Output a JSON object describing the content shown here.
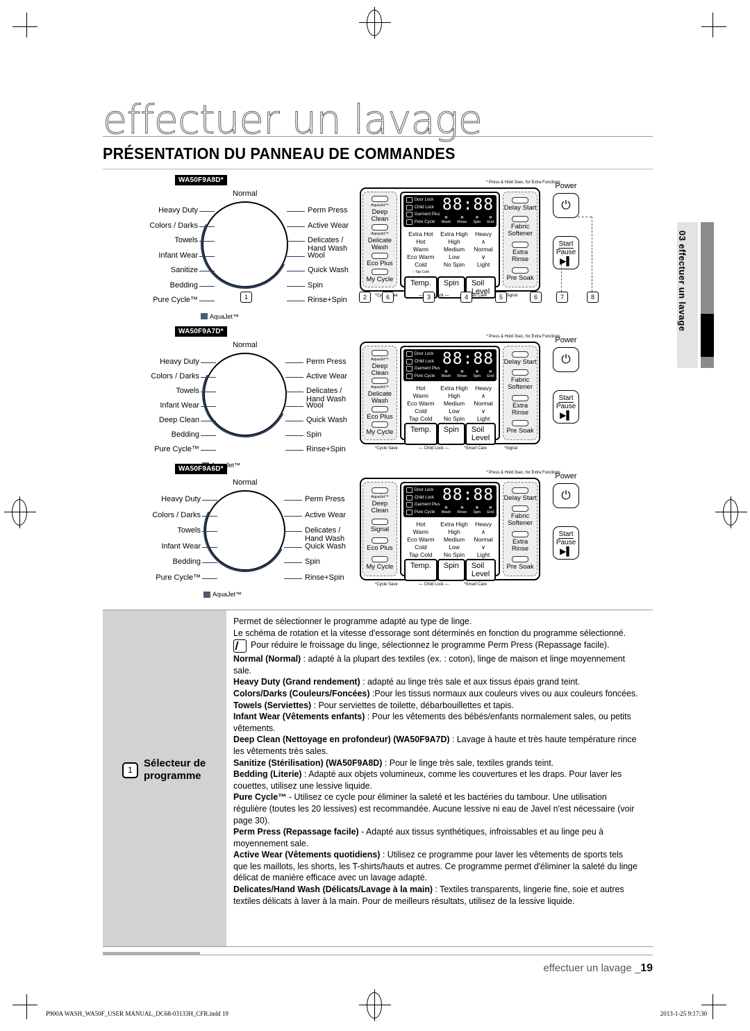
{
  "header": {
    "page_title": "effectuer un lavage",
    "section_title": "PRÉSENTATION DU PANNEAU DE COMMANDES",
    "side_tab": "03 effectuer un lavage"
  },
  "panels": [
    {
      "model": "WA50F9A8D*",
      "dial_left": [
        "Heavy Duty",
        "Colors / Darks",
        "Towels",
        "Infant Wear",
        "Sanitize",
        "Bedding",
        "Pure Cycle™"
      ],
      "dial_top": "Normal",
      "dial_right": [
        "Perm Press",
        "Active Wear",
        "Delicates /\nHand Wash",
        "Wool",
        "Quick Wash",
        "Spin",
        "Rinse+Spin"
      ],
      "aqua_badge": "AquaJet™",
      "left_buttons": [
        {
          "sup": "AquaJet™",
          "label": "Deep Clean"
        },
        {
          "sup": "AquaJet™",
          "label": "Delicate\nWash"
        },
        {
          "sup": "",
          "label": "Eco Plus"
        },
        {
          "sup": "",
          "label": "My Cycle"
        }
      ],
      "right_buttons": [
        {
          "sup": "",
          "label": "Delay Start"
        },
        {
          "sup": "",
          "label": "Fabric\nSoftener"
        },
        {
          "sup": "",
          "label": "Extra Rinse"
        },
        {
          "sup": "",
          "label": "Pre Soak"
        }
      ],
      "lcd_indicators": [
        "Door Lock",
        "Child Lock",
        "Garment Plus",
        "Pure Cycle"
      ],
      "lcd_display": "88:88",
      "lcd_steps": [
        "Wash",
        "Rinse",
        "Spin",
        "End"
      ],
      "temp_options": [
        "Extra Hot",
        "Hot",
        "Warm",
        "Eco Warm",
        "Cold"
      ],
      "temp_sub": "Tap Cold",
      "spin_options": [
        "Extra High",
        "High",
        "Medium",
        "Low",
        "No Spin"
      ],
      "soil_options": [
        "Heavy",
        "∧",
        "Normal",
        "∨",
        "Light"
      ],
      "main_buttons": [
        "Temp.",
        "Spin",
        "Soil Level"
      ],
      "power_label": "Power",
      "start_label_top": "Start",
      "start_label_bottom": "Pause",
      "hint": "* Press & Hold 3sec. for Extra Functions",
      "undertext": [
        "*Cycle Save",
        "— Child Lock —",
        "*Smart Care",
        "*Signal"
      ],
      "callouts": [
        "1",
        "2",
        "6",
        "3",
        "4",
        "5",
        "6",
        "7",
        "8"
      ]
    },
    {
      "model": "WA50F9A7D*",
      "dial_left": [
        "Heavy Duty",
        "Colors / Darks",
        "Towels",
        "Infant Wear",
        "Deep Clean",
        "Bedding",
        "Pure Cycle™"
      ],
      "dial_top": "Normal",
      "dial_right": [
        "Perm Press",
        "Active Wear",
        "Delicates /\nHand Wash",
        "Wool",
        "Quick Wash",
        "Spin",
        "Rinse+Spin"
      ],
      "aqua_badge": "AquaJet™",
      "left_buttons": [
        {
          "sup": "AquaJet™",
          "label": "Deep Clean"
        },
        {
          "sup": "AquaJet™",
          "label": "Delicate\nWash"
        },
        {
          "sup": "",
          "label": "Eco Plus"
        },
        {
          "sup": "",
          "label": "My Cycle"
        }
      ],
      "right_buttons": [
        {
          "sup": "",
          "label": "Delay Start"
        },
        {
          "sup": "",
          "label": "Fabric\nSoftener"
        },
        {
          "sup": "",
          "label": "Extra Rinse"
        },
        {
          "sup": "",
          "label": "Pre Soak"
        }
      ],
      "lcd_indicators": [
        "Door Lock",
        "Child Lock",
        "Garment Plus",
        "Pure Cycle"
      ],
      "lcd_display": "88:88",
      "lcd_steps": [
        "Wash",
        "Rinse",
        "Spin",
        "End"
      ],
      "temp_options": [
        "Hot",
        "Warm",
        "Eco Warm",
        "Cold",
        "Tap Cold"
      ],
      "temp_sub": "",
      "spin_options": [
        "Extra High",
        "High",
        "Medium",
        "Low",
        "No Spin"
      ],
      "soil_options": [
        "Heavy",
        "∧",
        "Normal",
        "∨",
        "Light"
      ],
      "main_buttons": [
        "Temp.",
        "Spin",
        "Soil Level"
      ],
      "power_label": "Power",
      "start_label_top": "Start",
      "start_label_bottom": "Pause",
      "hint": "* Press & Hold 3sec. for Extra Functions",
      "undertext": [
        "*Cycle Save",
        "— Child Lock —",
        "*Smart Care",
        "*Signal"
      ],
      "callouts": []
    },
    {
      "model": "WA50F9A6D*",
      "dial_left": [
        "Heavy Duty",
        "Colors / Darks",
        "Towels",
        "Infant Wear",
        "Bedding",
        "Pure Cycle™"
      ],
      "dial_top": "Normal",
      "dial_right": [
        "Perm Press",
        "Active Wear",
        "Delicates /\nHand Wash",
        "Quick Wash",
        "Spin",
        "Rinse+Spin"
      ],
      "aqua_badge": "AquaJet™",
      "left_buttons": [
        {
          "sup": "AquaJet™",
          "label": "Deep Clean"
        },
        {
          "sup": "",
          "label": "Signal"
        },
        {
          "sup": "",
          "label": "Eco Plus"
        },
        {
          "sup": "",
          "label": "My Cycle"
        }
      ],
      "right_buttons": [
        {
          "sup": "",
          "label": "Delay Start"
        },
        {
          "sup": "",
          "label": "Fabric\nSoftener"
        },
        {
          "sup": "",
          "label": "Extra Rinse"
        },
        {
          "sup": "",
          "label": "Pre Soak"
        }
      ],
      "lcd_indicators": [
        "Door Lock",
        "Child Lock",
        "Garment Plus",
        "Pure Cycle"
      ],
      "lcd_display": "88:88",
      "lcd_steps": [
        "Wash",
        "Rinse",
        "Spin",
        "End"
      ],
      "temp_options": [
        "Hot",
        "Warm",
        "Eco Warm",
        "Cold",
        "Tap Cold"
      ],
      "temp_sub": "",
      "spin_options": [
        "Extra High",
        "High",
        "Medium",
        "Low",
        "No Spin"
      ],
      "soil_options": [
        "Heavy",
        "∧",
        "Normal",
        "∨",
        "Light"
      ],
      "main_buttons": [
        "Temp.",
        "Spin",
        "Soil Level"
      ],
      "power_label": "Power",
      "start_label_top": "Start",
      "start_label_bottom": "Pause",
      "hint": "* Press & Hold 3sec. for Extra Functions",
      "undertext": [
        "*Cycle Save",
        "— Child Lock —",
        "*Smart Care"
      ],
      "callouts": []
    }
  ],
  "description": {
    "callout_number": "1",
    "label": "Sélecteur de\nprogramme",
    "intro_1": "Permet de sélectionner le programme adapté au type de linge.",
    "intro_2": "Le schéma de rotation et la vitesse d'essorage sont déterminés en fonction du programme sélectionné.",
    "note": "Pour réduire le froissage du linge, sélectionnez le programme Perm Press (Repassage facile).",
    "items": [
      {
        "term": "Normal (Normal)",
        "text": " : adapté à la plupart des textiles (ex. : coton), linge de maison et linge moyennement sale."
      },
      {
        "term": "Heavy Duty (Grand rendement)",
        "text": " : adapté au linge très sale et aux tissus épais grand teint."
      },
      {
        "term": "Colors/Darks (Couleurs/Foncées)",
        "text": " :Pour les tissus normaux aux couleurs vives ou aux couleurs foncées."
      },
      {
        "term": "Towels (Serviettes)",
        "text": " : Pour serviettes de toilette, débarbouillettes et tapis."
      },
      {
        "term": "Infant Wear (Vêtements enfants)",
        "text": " : Pour les vêtements des bébés/enfants normalement sales, ou petits vêtements."
      },
      {
        "term": "Deep Clean (Nettoyage en profondeur) (WA50F9A7D)",
        "text": " : Lavage à haute et très haute température rince les vêtements très sales."
      },
      {
        "term": "Sanitize (Stérilisation) (WA50F9A8D)",
        "text": " : Pour le linge très sale, textiles grands teint."
      },
      {
        "term": "Bedding (Literie)",
        "text": " : Adapté aux objets volumineux, comme les couvertures et les draps. Pour laver les couettes, utilisez une lessive liquide."
      },
      {
        "term": "Pure Cycle™",
        "text": " - Utilisez ce cycle pour éliminer la saleté et les bactéries du tambour.  Une utilisation régulière (toutes les 20 lessives) est recommandée. Aucune lessive ni eau de Javel n'est nécessaire (voir page 30)."
      },
      {
        "term": "Perm Press (Repassage facile)",
        "text": " - Adapté aux tissus synthétiques, infroissables et au linge peu à moyennement sale."
      },
      {
        "term": "Active Wear (Vêtements quotidiens)",
        "text": "  : Utilisez ce programme pour laver les vêtements de sports tels que les maillots, les shorts, les T-shirts/hauts et autres.  Ce programme permet d'éliminer la saleté du linge délicat de manière efficace avec un lavage adapté."
      },
      {
        "term": "Delicates/Hand Wash (Délicats/Lavage à la main)",
        "text": " : Textiles transparents, lingerie fine, soie et autres textiles délicats à laver à la main.  Pour de meilleurs résultats, utilisez de la lessive liquide."
      }
    ]
  },
  "footer": {
    "running_text": "effectuer un lavage _",
    "page_number": "19",
    "file_name": "P900A WASH_WA50F_USER MANUAL_DC68-03133H_CFR.indd   19",
    "timestamp": "2013-1-25   9:17:30"
  }
}
